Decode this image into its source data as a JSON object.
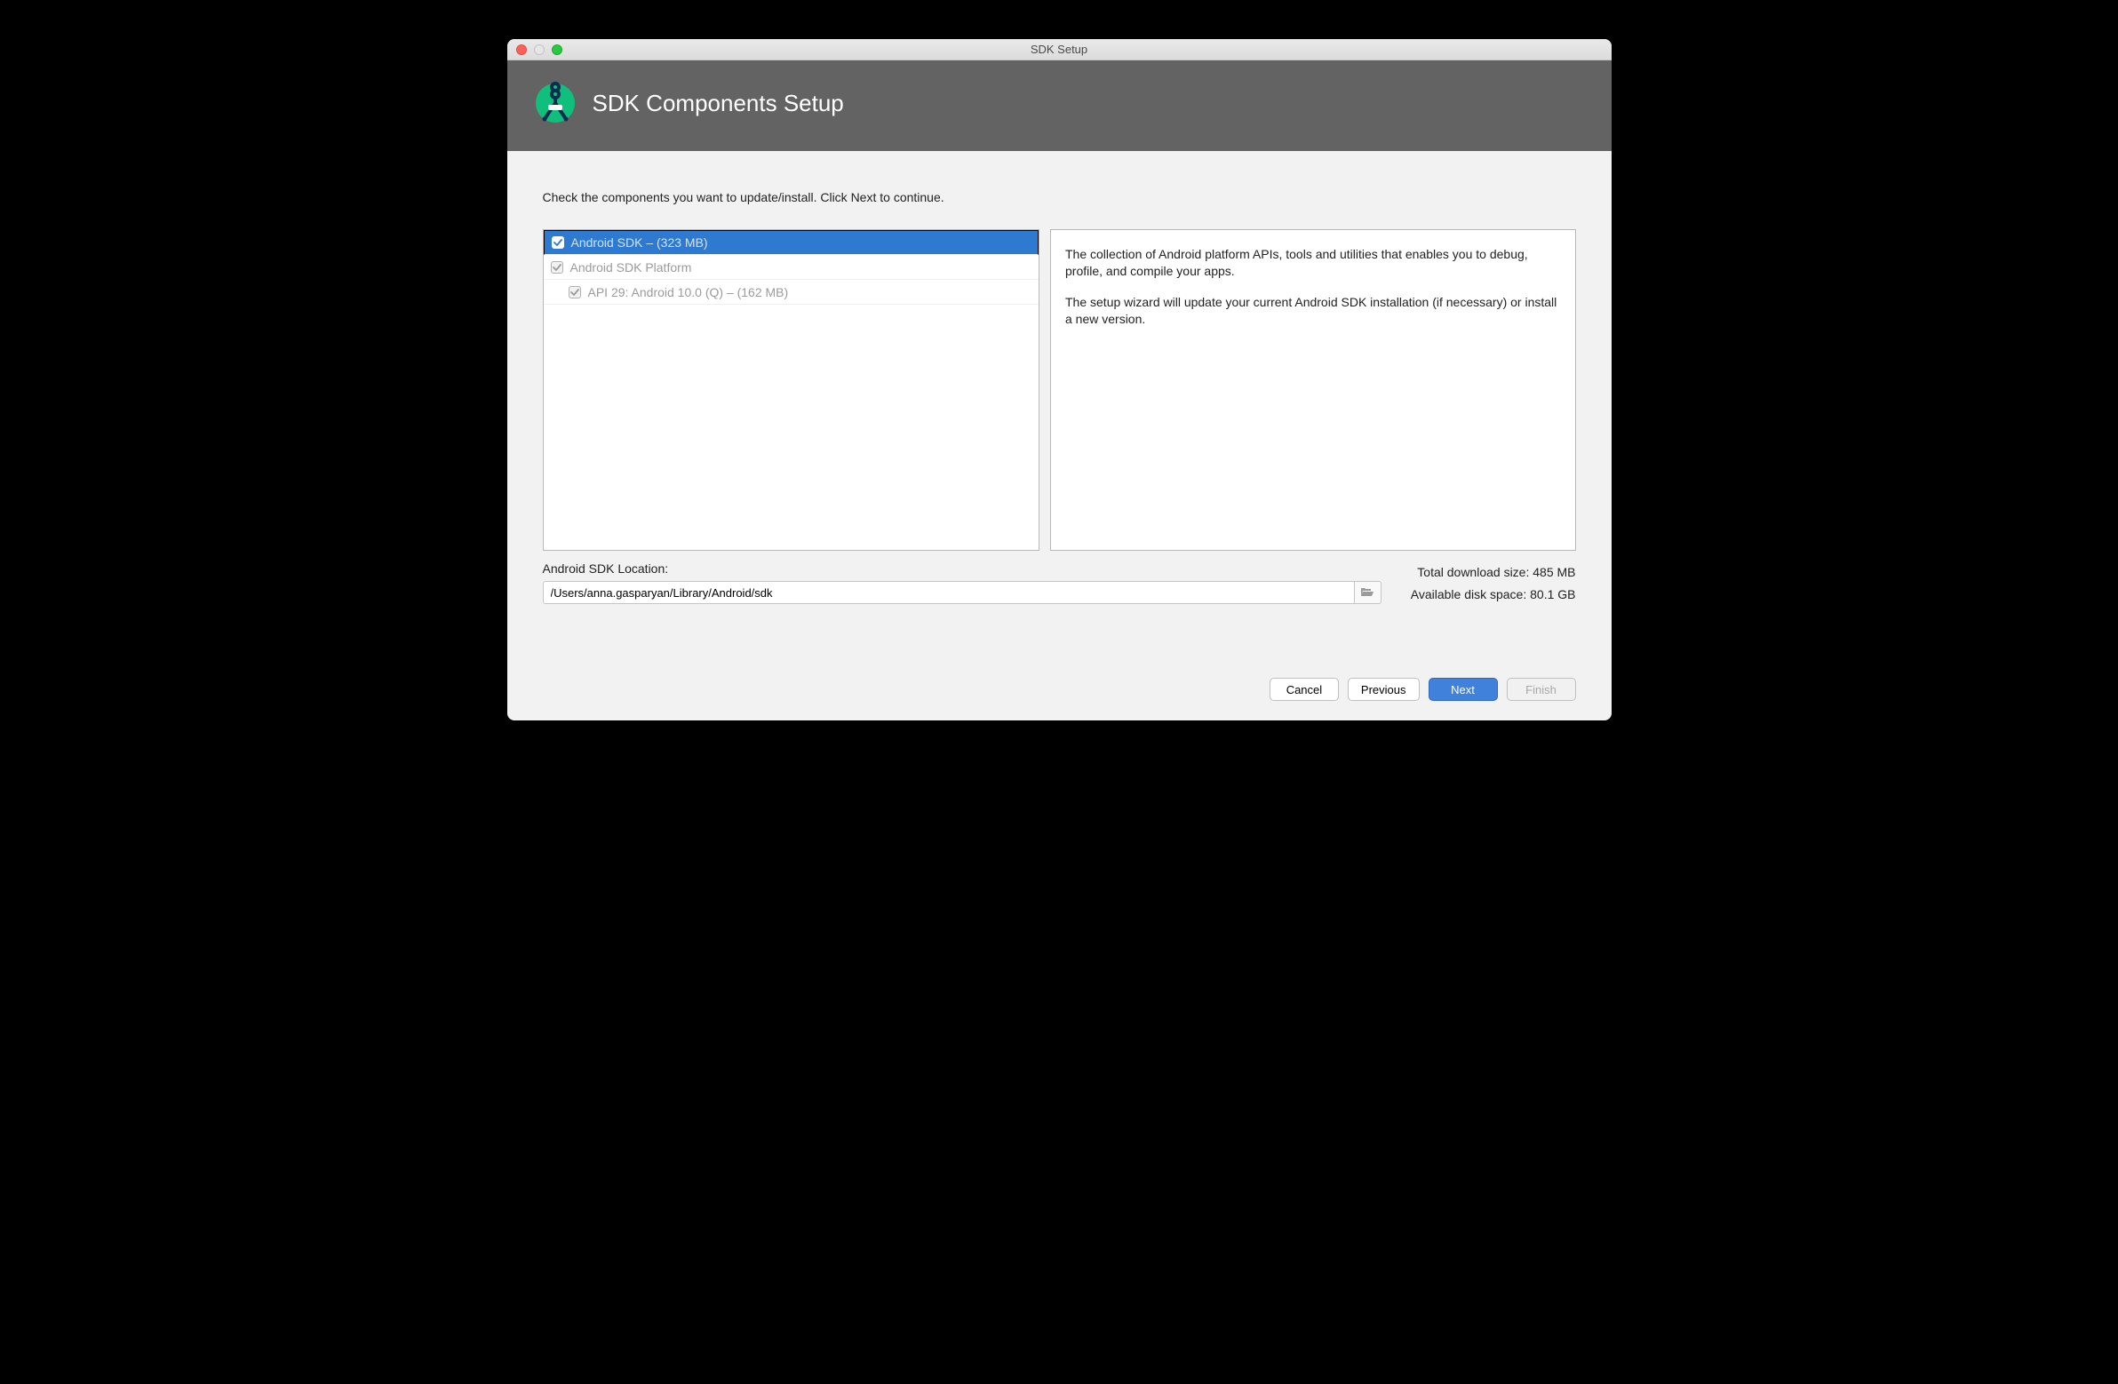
{
  "window": {
    "title": "SDK Setup"
  },
  "banner": {
    "title": "SDK Components Setup"
  },
  "instruction": "Check the components you want to update/install. Click Next to continue.",
  "components": [
    {
      "label": "Android SDK – (323 MB)",
      "indent": 1,
      "selected": true,
      "checked": true,
      "disabled": false
    },
    {
      "label": "Android SDK Platform",
      "indent": 1,
      "selected": false,
      "checked": true,
      "disabled": true
    },
    {
      "label": "API 29: Android 10.0 (Q) – (162 MB)",
      "indent": 2,
      "selected": false,
      "checked": true,
      "disabled": true
    }
  ],
  "description": {
    "p1": "The collection of Android platform APIs, tools and utilities that enables you to debug, profile, and compile your apps.",
    "p2": "The setup wizard will update your current Android SDK installation (if necessary) or install a new version."
  },
  "sdk_location": {
    "label": "Android SDK Location:",
    "value": "/Users/anna.gasparyan/Library/Android/sdk"
  },
  "stats": {
    "download_label": "Total download size: 485 MB",
    "disk_label": "Available disk space: 80.1 GB"
  },
  "buttons": {
    "cancel": "Cancel",
    "previous": "Previous",
    "next": "Next",
    "finish": "Finish"
  }
}
